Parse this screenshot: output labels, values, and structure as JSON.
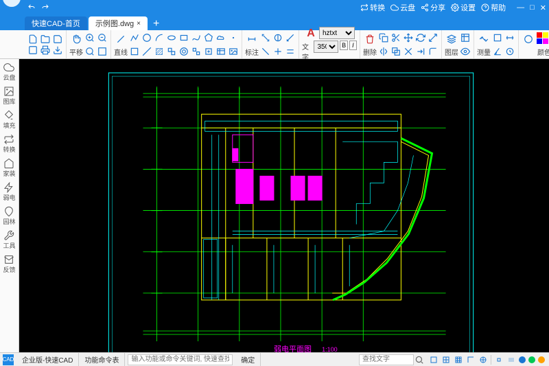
{
  "title": {
    "home": "快速CAD-首页",
    "file": "示例图.dwg"
  },
  "titlebar": {
    "convert": "转换",
    "cloud": "云盘",
    "share": "分享",
    "settings": "设置",
    "help": "帮助"
  },
  "toolbar": {
    "pan": "平移",
    "line": "直线",
    "annotate": "标注",
    "text": "文字",
    "font": "hztxt",
    "fontsize": "350",
    "bold": "B",
    "italic": "I",
    "delete": "删除",
    "layer": "图层",
    "measure": "测量",
    "color": "颜色"
  },
  "sidebar": {
    "items": [
      {
        "label": "云盘",
        "icon": "cloud"
      },
      {
        "label": "图库",
        "icon": "gallery"
      },
      {
        "label": "填充",
        "icon": "fill"
      },
      {
        "label": "转换",
        "icon": "convert"
      },
      {
        "label": "家装",
        "icon": "home"
      },
      {
        "label": "弱电",
        "icon": "elec"
      },
      {
        "label": "园林",
        "icon": "garden"
      },
      {
        "label": "工具",
        "icon": "tools"
      },
      {
        "label": "反馈",
        "icon": "feedback"
      }
    ]
  },
  "drawing": {
    "title": "弱电平面图",
    "scale": "1:100"
  },
  "statusbar": {
    "edition": "企业版-快速CAD",
    "cmdtable": "功能命令表",
    "cmd_placeholder": "输入功能或命令关键词, 快速查找功能",
    "ok": "确定",
    "search_placeholder": "查找文字"
  },
  "colors": [
    "#ff0000",
    "#ffff00",
    "#00ff00",
    "#00ffff",
    "#000000",
    "#0000ff",
    "#ff00ff",
    "#808080",
    "#800000",
    "#008000"
  ]
}
